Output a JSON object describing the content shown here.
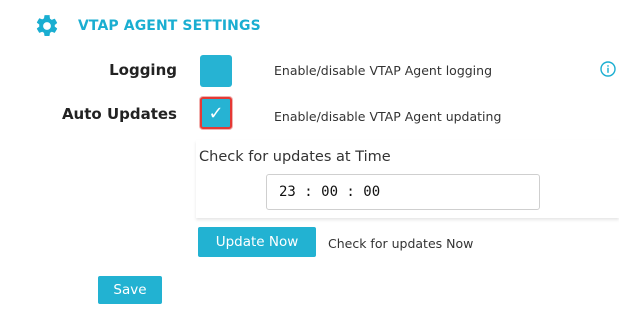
{
  "header": {
    "title": "VTAP AGENT SETTINGS",
    "icon": "gear-icon"
  },
  "logging": {
    "label": "Logging",
    "description": "Enable/disable VTAP Agent logging",
    "checked": false,
    "info_icon": "info-icon"
  },
  "auto_updates": {
    "label": "Auto Updates",
    "description": "Enable/disable VTAP Agent updating",
    "checked": true,
    "check_mark": "✓"
  },
  "schedule": {
    "label": "Check for updates at Time",
    "time_value": "23 : 00 : 00"
  },
  "update_now": {
    "button_label": "Update Now",
    "description": "Check for updates Now"
  },
  "save": {
    "button_label": "Save"
  },
  "colors": {
    "accent": "#22b2d2",
    "title": "#1aaed1",
    "focus_border": "#e53935"
  }
}
